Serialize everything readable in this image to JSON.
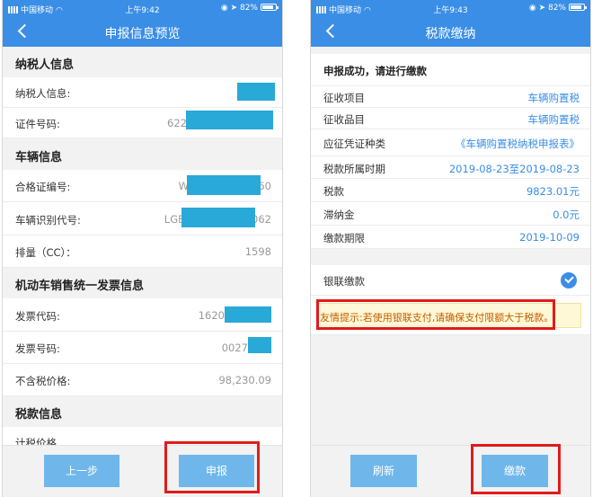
{
  "left": {
    "status": {
      "carrier": "中国移动",
      "time": "上午9:42",
      "battery": "82%"
    },
    "title": "申报信息预览",
    "taxpayer_section": "纳税人信息",
    "taxpayer_label": "纳税人信息:",
    "id_label": "证件号码:",
    "id_prefix": "622",
    "vehicle_section": "车辆信息",
    "cert_label": "合格证编号:",
    "cert_prefix": "W",
    "cert_suffix": "60",
    "vin_label": "车辆识别代号:",
    "vin_prefix": "LGB",
    "vin_suffix": "062",
    "disp_label": "排量（CC）：",
    "disp_value": "1598",
    "invoice_section": "机动车销售统一发票信息",
    "inv_code_label": "发票代码:",
    "inv_code_prefix": "1620",
    "inv_no_label": "发票号码:",
    "inv_no_prefix": "0027",
    "price_label": "不含税价格:",
    "price_value": "98,230.09",
    "tax_section": "税款信息",
    "taxprice_label": "计税价格",
    "prev_button": "上一步",
    "submit_button": "申报"
  },
  "right": {
    "status": {
      "carrier": "中国移动",
      "time": "上午9:43",
      "battery": "82%"
    },
    "title": "税款缴纳",
    "success_msg": "申报成功，请进行缴款",
    "rows": [
      {
        "label": "征收项目",
        "value": "车辆购置税"
      },
      {
        "label": "征收品目",
        "value": "车辆购置税"
      },
      {
        "label": "应征凭证种类",
        "value": "《车辆购置税纳税申报表》"
      },
      {
        "label": "税款所属时期",
        "value": "2019-08-23至2019-08-23"
      },
      {
        "label": "税款",
        "value": "9823.01元"
      },
      {
        "label": "滞纳金",
        "value": "0.0元"
      },
      {
        "label": "缴款期限",
        "value": "2019-10-09"
      }
    ],
    "unionpay_label": "银联缴款",
    "tip": "友情提示:若使用银联支付,请确保支付限额大于税款。",
    "refresh_button": "刷新",
    "pay_button": "缴款"
  },
  "colors": {
    "header": "#3a8ee6",
    "button": "#6fb7ea",
    "mask": "#29a9d8",
    "highlight": "#e01b1b"
  }
}
